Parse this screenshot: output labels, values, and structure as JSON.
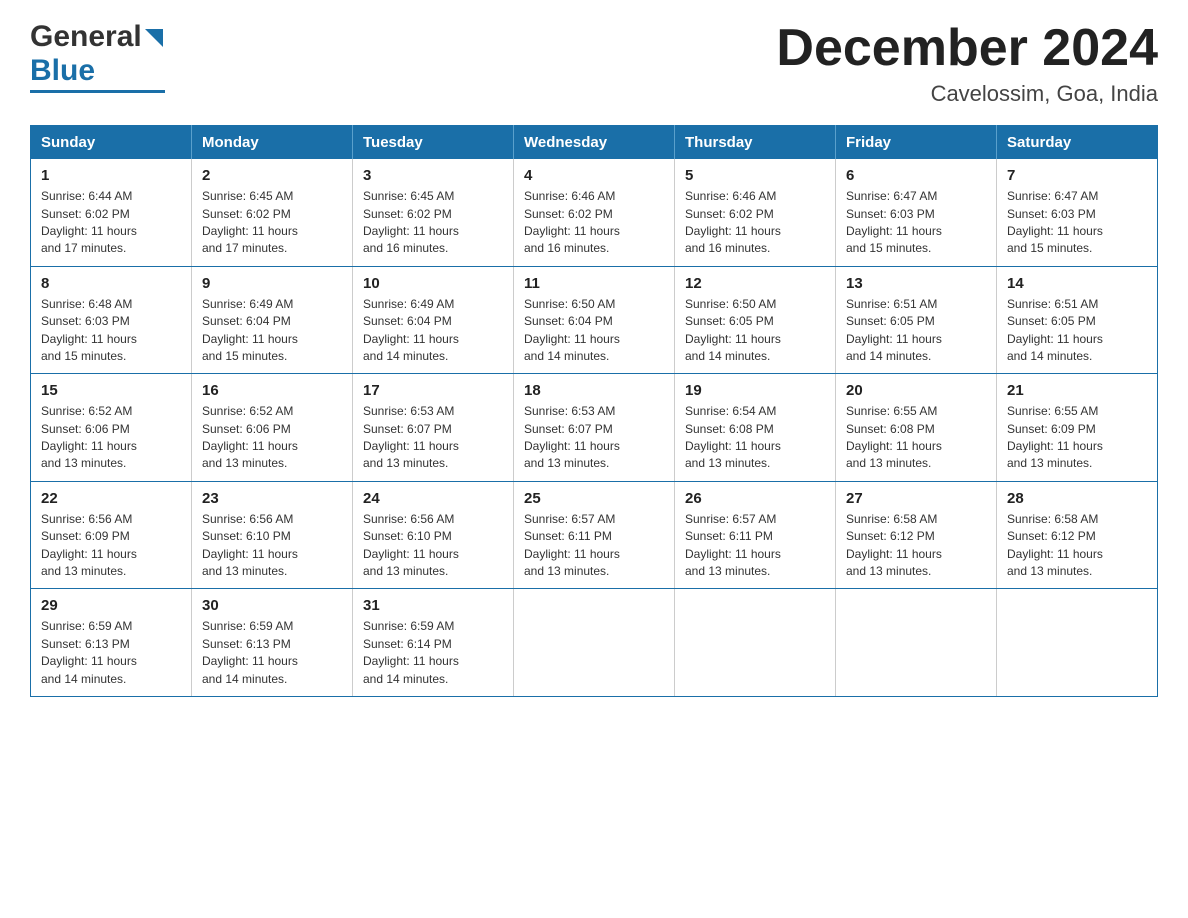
{
  "header": {
    "logo_general": "General",
    "logo_blue": "Blue",
    "month_title": "December 2024",
    "subtitle": "Cavelossim, Goa, India"
  },
  "weekdays": [
    "Sunday",
    "Monday",
    "Tuesday",
    "Wednesday",
    "Thursday",
    "Friday",
    "Saturday"
  ],
  "weeks": [
    [
      {
        "day": "1",
        "sunrise": "6:44 AM",
        "sunset": "6:02 PM",
        "daylight": "11 hours and 17 minutes."
      },
      {
        "day": "2",
        "sunrise": "6:45 AM",
        "sunset": "6:02 PM",
        "daylight": "11 hours and 17 minutes."
      },
      {
        "day": "3",
        "sunrise": "6:45 AM",
        "sunset": "6:02 PM",
        "daylight": "11 hours and 16 minutes."
      },
      {
        "day": "4",
        "sunrise": "6:46 AM",
        "sunset": "6:02 PM",
        "daylight": "11 hours and 16 minutes."
      },
      {
        "day": "5",
        "sunrise": "6:46 AM",
        "sunset": "6:02 PM",
        "daylight": "11 hours and 16 minutes."
      },
      {
        "day": "6",
        "sunrise": "6:47 AM",
        "sunset": "6:03 PM",
        "daylight": "11 hours and 15 minutes."
      },
      {
        "day": "7",
        "sunrise": "6:47 AM",
        "sunset": "6:03 PM",
        "daylight": "11 hours and 15 minutes."
      }
    ],
    [
      {
        "day": "8",
        "sunrise": "6:48 AM",
        "sunset": "6:03 PM",
        "daylight": "11 hours and 15 minutes."
      },
      {
        "day": "9",
        "sunrise": "6:49 AM",
        "sunset": "6:04 PM",
        "daylight": "11 hours and 15 minutes."
      },
      {
        "day": "10",
        "sunrise": "6:49 AM",
        "sunset": "6:04 PM",
        "daylight": "11 hours and 14 minutes."
      },
      {
        "day": "11",
        "sunrise": "6:50 AM",
        "sunset": "6:04 PM",
        "daylight": "11 hours and 14 minutes."
      },
      {
        "day": "12",
        "sunrise": "6:50 AM",
        "sunset": "6:05 PM",
        "daylight": "11 hours and 14 minutes."
      },
      {
        "day": "13",
        "sunrise": "6:51 AM",
        "sunset": "6:05 PM",
        "daylight": "11 hours and 14 minutes."
      },
      {
        "day": "14",
        "sunrise": "6:51 AM",
        "sunset": "6:05 PM",
        "daylight": "11 hours and 14 minutes."
      }
    ],
    [
      {
        "day": "15",
        "sunrise": "6:52 AM",
        "sunset": "6:06 PM",
        "daylight": "11 hours and 13 minutes."
      },
      {
        "day": "16",
        "sunrise": "6:52 AM",
        "sunset": "6:06 PM",
        "daylight": "11 hours and 13 minutes."
      },
      {
        "day": "17",
        "sunrise": "6:53 AM",
        "sunset": "6:07 PM",
        "daylight": "11 hours and 13 minutes."
      },
      {
        "day": "18",
        "sunrise": "6:53 AM",
        "sunset": "6:07 PM",
        "daylight": "11 hours and 13 minutes."
      },
      {
        "day": "19",
        "sunrise": "6:54 AM",
        "sunset": "6:08 PM",
        "daylight": "11 hours and 13 minutes."
      },
      {
        "day": "20",
        "sunrise": "6:55 AM",
        "sunset": "6:08 PM",
        "daylight": "11 hours and 13 minutes."
      },
      {
        "day": "21",
        "sunrise": "6:55 AM",
        "sunset": "6:09 PM",
        "daylight": "11 hours and 13 minutes."
      }
    ],
    [
      {
        "day": "22",
        "sunrise": "6:56 AM",
        "sunset": "6:09 PM",
        "daylight": "11 hours and 13 minutes."
      },
      {
        "day": "23",
        "sunrise": "6:56 AM",
        "sunset": "6:10 PM",
        "daylight": "11 hours and 13 minutes."
      },
      {
        "day": "24",
        "sunrise": "6:56 AM",
        "sunset": "6:10 PM",
        "daylight": "11 hours and 13 minutes."
      },
      {
        "day": "25",
        "sunrise": "6:57 AM",
        "sunset": "6:11 PM",
        "daylight": "11 hours and 13 minutes."
      },
      {
        "day": "26",
        "sunrise": "6:57 AM",
        "sunset": "6:11 PM",
        "daylight": "11 hours and 13 minutes."
      },
      {
        "day": "27",
        "sunrise": "6:58 AM",
        "sunset": "6:12 PM",
        "daylight": "11 hours and 13 minutes."
      },
      {
        "day": "28",
        "sunrise": "6:58 AM",
        "sunset": "6:12 PM",
        "daylight": "11 hours and 13 minutes."
      }
    ],
    [
      {
        "day": "29",
        "sunrise": "6:59 AM",
        "sunset": "6:13 PM",
        "daylight": "11 hours and 14 minutes."
      },
      {
        "day": "30",
        "sunrise": "6:59 AM",
        "sunset": "6:13 PM",
        "daylight": "11 hours and 14 minutes."
      },
      {
        "day": "31",
        "sunrise": "6:59 AM",
        "sunset": "6:14 PM",
        "daylight": "11 hours and 14 minutes."
      },
      null,
      null,
      null,
      null
    ]
  ],
  "labels": {
    "sunrise": "Sunrise:",
    "sunset": "Sunset:",
    "daylight": "Daylight:"
  }
}
